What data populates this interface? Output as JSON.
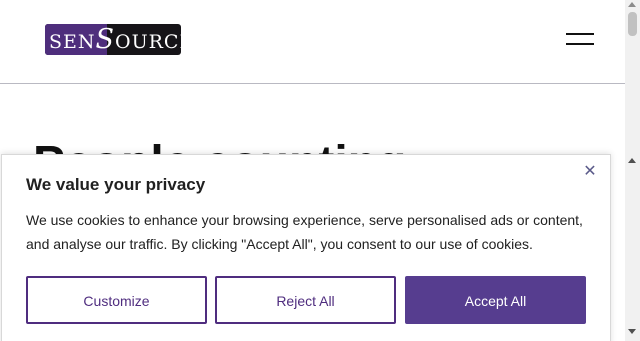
{
  "header": {
    "logo_text_left": "SEN",
    "logo_text_big": "S",
    "logo_text_right": "OURCE",
    "menu_icon": "hamburger-menu-icon"
  },
  "background": {
    "heading_partial": "People counting"
  },
  "cookie_banner": {
    "title": "We value your privacy",
    "close_symbol": "✕",
    "description": "We use cookies to enhance your browsing experience, serve personalised ads or content, and analyse our traffic. By clicking \"Accept All\", you consent to our use of cookies.",
    "buttons": {
      "customize": "Customize",
      "reject": "Reject All",
      "accept": "Accept All"
    }
  },
  "colors": {
    "brand_purple": "#563d8f",
    "logo_purple": "#4e2e7c"
  }
}
